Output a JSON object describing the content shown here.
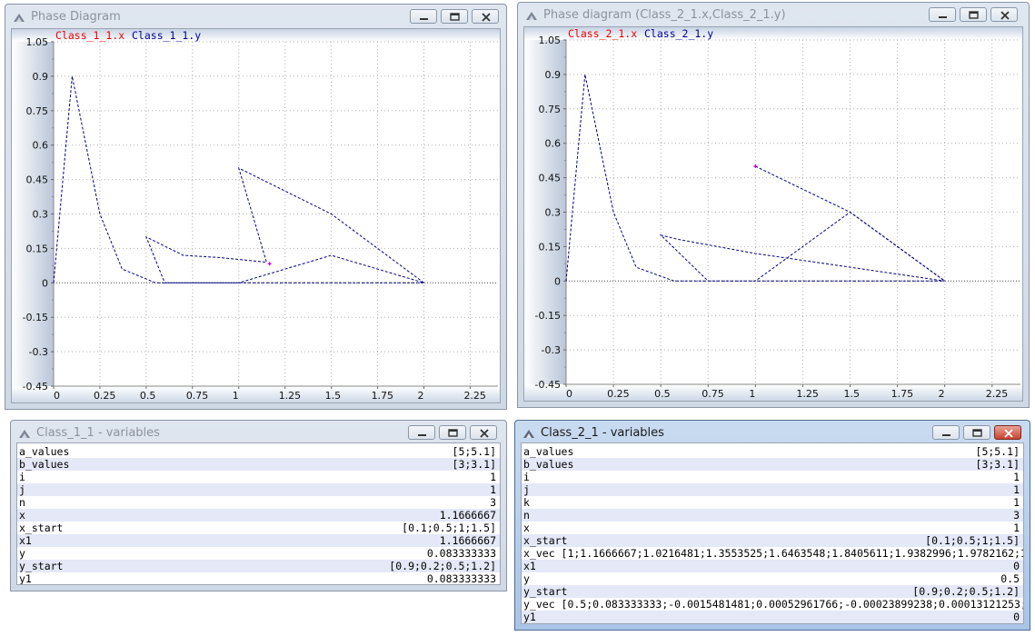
{
  "windows": {
    "phase1": {
      "title": "Phase Diagram",
      "legend": {
        "x": "Class_1_1.x",
        "y": "Class_1_1.y"
      },
      "chart_data": {
        "type": "line",
        "xlim": [
          0,
          2.4
        ],
        "ylim": [
          -0.45,
          1.05
        ],
        "x_ticks": [
          "0",
          "0.25",
          "0.5",
          "0.75",
          "1",
          "1.25",
          "1.5",
          "1.75",
          "2",
          "2.25"
        ],
        "y_ticks": [
          "1.05",
          "0.9",
          "0.75",
          "0.6",
          "0.45",
          "0.3",
          "0.15",
          "0",
          "-0.15",
          "-0.3",
          "-0.45"
        ],
        "grid": true,
        "series": [
          {
            "x": [
              0,
              0.1,
              0.25,
              0.37,
              0.55,
              0.62,
              0.75,
              1.0,
              1.2,
              1.5,
              2.0,
              1.5,
              1.0,
              0.6,
              0.5,
              0.7,
              0.9,
              1.15,
              1.0,
              1.5,
              2.0
            ],
            "y": [
              0,
              0.9,
              0.3,
              0.06,
              0.0,
              0.0,
              0.0,
              0.0,
              0.0,
              0.0,
              0.0,
              0.12,
              0.0,
              0.0,
              0.2,
              0.12,
              0.11,
              0.09,
              0.5,
              0.3,
              0.0
            ]
          }
        ],
        "marker": {
          "x": 1.1666667,
          "y": 0.083333333
        }
      }
    },
    "phase2": {
      "title": "Phase diagram (Class_2_1.x,Class_2_1.y)",
      "legend": {
        "x": "Class_2_1.x",
        "y": "Class_2_1.y"
      },
      "chart_data": {
        "type": "line",
        "xlim": [
          0,
          2.4
        ],
        "ylim": [
          -0.45,
          1.05
        ],
        "x_ticks": [
          "0",
          "0.25",
          "0.5",
          "0.75",
          "1",
          "1.25",
          "1.5",
          "1.75",
          "2",
          "2.25"
        ],
        "y_ticks": [
          "1.05",
          "0.9",
          "0.75",
          "0.6",
          "0.45",
          "0.3",
          "0.15",
          "0",
          "-0.15",
          "-0.3",
          "-0.45"
        ],
        "grid": true,
        "series": [
          {
            "x": [
              0,
              0.1,
              0.25,
              0.37,
              0.57,
              0.75,
              1.0,
              1.5,
              2.0,
              1.5,
              1.0,
              0.6,
              0.5,
              0.75,
              1.0,
              1.5,
              2.0
            ],
            "y": [
              0,
              0.9,
              0.3,
              0.06,
              0.0,
              0.0,
              0.0,
              0.0,
              0.0,
              0.06,
              0.12,
              0.18,
              0.2,
              0.0,
              0.0,
              0.3,
              0.0
            ]
          },
          {
            "x": [
              1.0,
              1.5,
              2.0
            ],
            "y": [
              0.5,
              0.3,
              0.0
            ]
          }
        ],
        "marker": {
          "x": 1.0,
          "y": 0.5
        }
      }
    },
    "vars1": {
      "title": "Class_1_1 - variables",
      "rows": [
        {
          "name": "a_values",
          "value": "[5;5.1]"
        },
        {
          "name": "b_values",
          "value": "[3;3.1]"
        },
        {
          "name": "i",
          "value": "1"
        },
        {
          "name": "j",
          "value": "1"
        },
        {
          "name": "n",
          "value": "3"
        },
        {
          "name": "x",
          "value": "1.1666667"
        },
        {
          "name": "x_start",
          "value": "[0.1;0.5;1;1.5]"
        },
        {
          "name": "x1",
          "value": "1.1666667"
        },
        {
          "name": "y",
          "value": "0.083333333"
        },
        {
          "name": "y_start",
          "value": "[0.9;0.2;0.5;1.2]"
        },
        {
          "name": "y1",
          "value": "0.083333333"
        }
      ]
    },
    "vars2": {
      "title": "Class_2_1 - variables",
      "rows": [
        {
          "name": "a_values",
          "value": "[5;5.1]"
        },
        {
          "name": "b_values",
          "value": "[3;3.1]"
        },
        {
          "name": "i",
          "value": "1"
        },
        {
          "name": "j",
          "value": "1"
        },
        {
          "name": "k",
          "value": "1"
        },
        {
          "name": "n",
          "value": "3"
        },
        {
          "name": "x",
          "value": "1"
        },
        {
          "name": "x_start",
          "value": "[0.1;0.5;1;1.5]"
        },
        {
          "name": "x_vec [1;1.1666667;1.0216481;1.3553525;1.6463548;1.8405611;1.9382996;1.9782162;1",
          "value": ""
        },
        {
          "name": "x1",
          "value": "0"
        },
        {
          "name": "y",
          "value": "0.5"
        },
        {
          "name": "y_start",
          "value": "[0.9;0.2;0.5;1.2]"
        },
        {
          "name": "y_vec [0.5;0.083333333;-0.0015481481;0.00052961766;-0.00023899238;0.00013121253;",
          "value": ""
        },
        {
          "name": "y1",
          "value": "0"
        }
      ]
    }
  },
  "colors": {
    "legend_x": "#ee0000",
    "legend_y": "#000099",
    "curve": "#000080",
    "marker": "#cc00cc",
    "grid": "#b0b0b0"
  },
  "icons": {
    "window_icon": "app-icon",
    "minimize": "minimize-icon",
    "maximize": "maximize-icon",
    "close": "close-icon"
  }
}
